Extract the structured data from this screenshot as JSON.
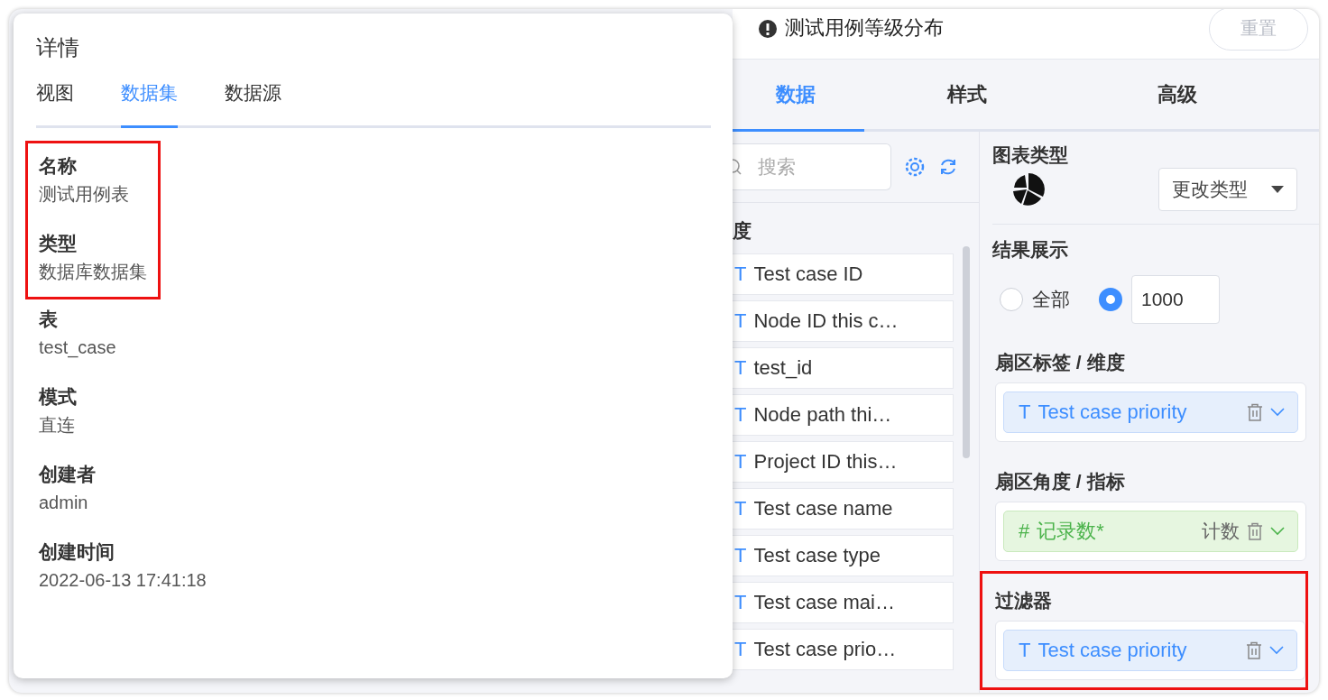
{
  "detail_panel": {
    "title": "详情",
    "tabs": [
      {
        "label": "视图",
        "selected": false
      },
      {
        "label": "数据集",
        "selected": true
      },
      {
        "label": "数据源",
        "selected": false
      }
    ],
    "field_groups": [
      {
        "highlighted": true,
        "fields": [
          {
            "label": "名称",
            "value": "测试用例表"
          },
          {
            "label": "类型",
            "value": "数据库数据集"
          }
        ]
      },
      {
        "highlighted": false,
        "fields": [
          {
            "label": "表",
            "value": "test_case"
          },
          {
            "label": "模式",
            "value": "直连"
          },
          {
            "label": "创建者",
            "value": "admin"
          },
          {
            "label": "创建时间",
            "value": "2022-06-13 17:41:18"
          }
        ]
      }
    ]
  },
  "editor": {
    "chart_title": "测试用例等级分布",
    "reset_button": {
      "label": "重置",
      "disabled": true
    },
    "tabs": [
      {
        "label": "数据",
        "selected": true
      },
      {
        "label": "样式",
        "selected": false
      },
      {
        "label": "高级",
        "selected": false
      }
    ],
    "search": {
      "placeholder": "搜索"
    },
    "field_section_label": "度",
    "fields": [
      {
        "icon": "T",
        "name": "Test case ID"
      },
      {
        "icon": "T",
        "name": "Node ID this c…"
      },
      {
        "icon": "T",
        "name": "test_id"
      },
      {
        "icon": "T",
        "name": "Node path thi…"
      },
      {
        "icon": "T",
        "name": "Project ID this…"
      },
      {
        "icon": "T",
        "name": "Test case name"
      },
      {
        "icon": "T",
        "name": "Test case type"
      },
      {
        "icon": "T",
        "name": "Test case mai…"
      },
      {
        "icon": "T",
        "name": "Test case prio…"
      }
    ],
    "chart_type": {
      "label": "图表类型",
      "button": "更改类型"
    },
    "result": {
      "label": "结果展示",
      "options": [
        {
          "kind": "all",
          "label": "全部",
          "selected": false
        },
        {
          "kind": "limit",
          "value": "1000",
          "selected": true
        }
      ]
    },
    "sections": [
      {
        "label": "扇区标签 / 维度",
        "highlighted": false,
        "chips": [
          {
            "kind": "dimension",
            "icon": "T",
            "name": "Test case priority"
          }
        ]
      },
      {
        "label": "扇区角度 / 指标",
        "highlighted": false,
        "chips": [
          {
            "kind": "measure",
            "icon": "#",
            "name": "记录数*",
            "aggregation": "计数"
          }
        ]
      },
      {
        "label": "过滤器",
        "highlighted": true,
        "chips": [
          {
            "kind": "dimension",
            "icon": "T",
            "name": "Test case priority"
          }
        ]
      }
    ]
  }
}
